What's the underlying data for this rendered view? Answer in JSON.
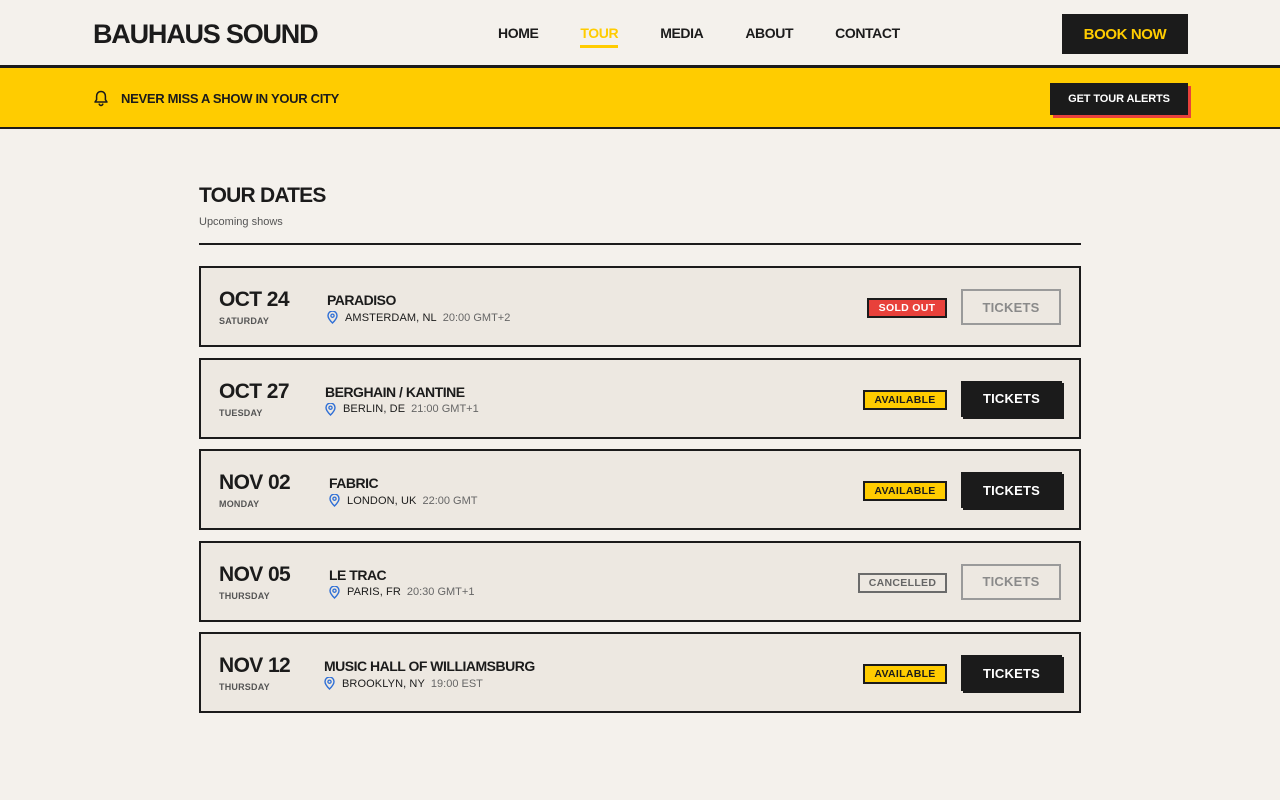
{
  "header": {
    "logo": "BAUHAUS SOUND",
    "nav": [
      "HOME",
      "TOUR",
      "MEDIA",
      "ABOUT",
      "CONTACT"
    ],
    "active_nav": "TOUR",
    "book_button": "BOOK NOW"
  },
  "banner": {
    "icon": "bell-icon",
    "text": "NEVER MISS A SHOW IN YOUR CITY",
    "button": "GET TOUR ALERTS"
  },
  "main": {
    "title": "TOUR DATES",
    "subtitle": "Upcoming shows",
    "ticket_label": "TICKETS",
    "shows": [
      {
        "date": "OCT 24",
        "weekday": "SATURDAY",
        "venue": "PARADISO",
        "city": "AMSTERDAM, NL",
        "time": "20:00 GMT+2",
        "status": "SOLD OUT",
        "status_type": "soldout"
      },
      {
        "date": "OCT 27",
        "weekday": "TUESDAY",
        "venue": "BERGHAIN / KANTINE",
        "city": "BERLIN, DE",
        "time": "21:00 GMT+1",
        "status": "AVAILABLE",
        "status_type": "available"
      },
      {
        "date": "NOV 02",
        "weekday": "MONDAY",
        "venue": "FABRIC",
        "city": "LONDON, UK",
        "time": "22:00 GMT",
        "status": "AVAILABLE",
        "status_type": "available"
      },
      {
        "date": "NOV 05",
        "weekday": "THURSDAY",
        "venue": "LE TRAC",
        "city": "PARIS, FR",
        "time": "20:30 GMT+1",
        "status": "CANCELLED",
        "status_type": "cancelled"
      },
      {
        "date": "NOV 12",
        "weekday": "THURSDAY",
        "venue": "MUSIC HALL OF WILLIAMSBURG",
        "city": "BROOKLYN, NY",
        "time": "19:00 EST",
        "status": "AVAILABLE",
        "status_type": "available"
      }
    ]
  },
  "colors": {
    "accent": "#ffcc00",
    "ink": "#1b1b1b",
    "danger": "#e8413b",
    "pin": "#2f6fd6",
    "background": "#f4f1ec"
  }
}
